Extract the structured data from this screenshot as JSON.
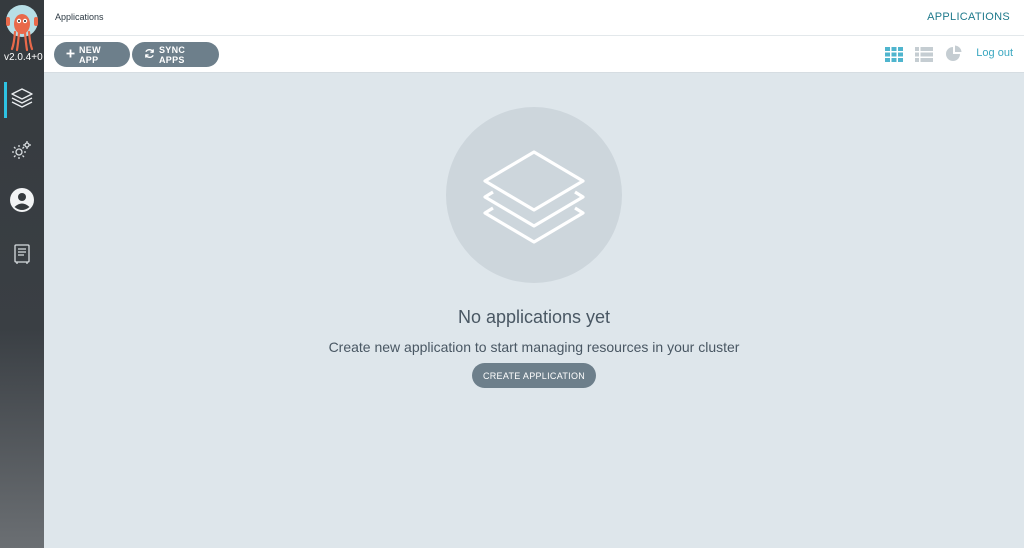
{
  "sidebar": {
    "version": "v2.0.4+0",
    "items": [
      {
        "name": "applications",
        "icon": "layers-icon",
        "active": true
      },
      {
        "name": "settings",
        "icon": "gears-icon",
        "active": false
      },
      {
        "name": "user-info",
        "icon": "user-circle-icon",
        "active": false
      },
      {
        "name": "docs",
        "icon": "book-icon",
        "active": false
      }
    ]
  },
  "header": {
    "breadcrumb": "Applications",
    "title": "APPLICATIONS"
  },
  "toolbar": {
    "new_app_label": "NEW APP",
    "sync_apps_label": "SYNC APPS",
    "view_modes": [
      "tiles-view-icon",
      "list-view-icon",
      "summary-pie-icon"
    ],
    "active_view": "tiles",
    "logout_label": "Log out"
  },
  "empty_state": {
    "icon": "layers-icon",
    "title": "No applications yet",
    "description": "Create new application to start managing resources in your cluster",
    "create_label": "CREATE APPLICATION"
  },
  "colors": {
    "accent": "#1f7a8c",
    "link": "#3ba8c1",
    "button": "#6d7f8b",
    "background": "#dee6eb",
    "sidebar": "#353a3e",
    "active_indicator": "#2ec2e2"
  }
}
